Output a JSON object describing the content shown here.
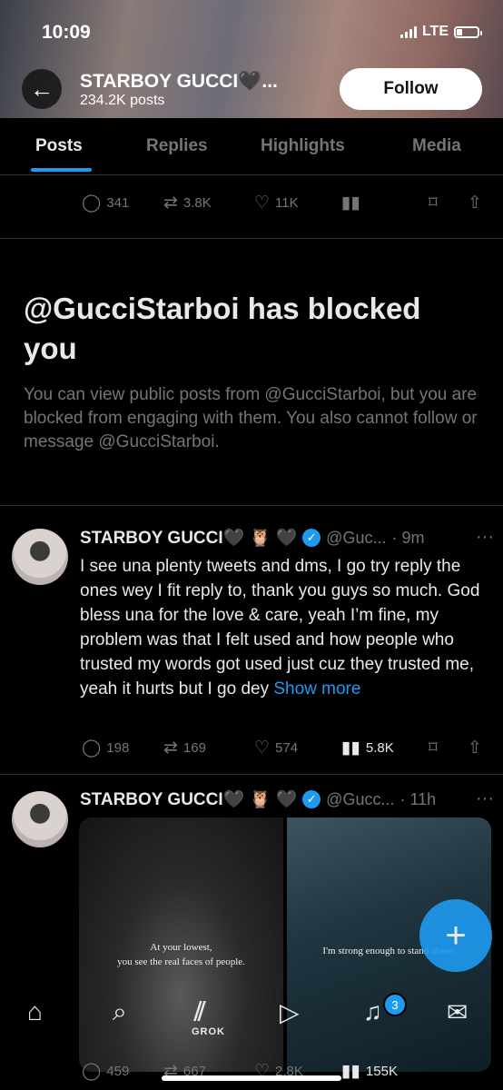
{
  "status_bar": {
    "time": "10:09",
    "network": "LTE"
  },
  "header": {
    "name": "STARBOY GUCCI🖤...",
    "posts_count": "234.2K posts",
    "follow_label": "Follow"
  },
  "tabs": [
    {
      "label": "Posts"
    },
    {
      "label": "Replies"
    },
    {
      "label": "Highlights"
    },
    {
      "label": "Media"
    }
  ],
  "prev_tweet_actions": {
    "replies": "341",
    "reposts": "3.8K",
    "likes": "11K"
  },
  "blocked_notice": {
    "title": "@GucciStarboi has blocked you",
    "text": "You can view public posts from @GucciStarboi, but you are blocked from engaging with them. You also cannot follow or message @GucciStarboi."
  },
  "tweet1": {
    "name": "STARBOY GUCCI🖤 🦉 🖤",
    "handle": "@Guc...",
    "time": "· 9m",
    "body": "I see una plenty tweets and dms, I go try reply the ones wey I fit reply to, thank you guys so much. God bless una for the love & care, yeah I’m fine, my problem was that I felt used and how people who trusted my words got used just cuz they trusted me, yeah it hurts but I go dey ",
    "show_more": "Show more",
    "replies": "198",
    "reposts": "169",
    "likes": "574",
    "views": "5.8K"
  },
  "tweet2": {
    "name": "STARBOY GUCCI🖤 🦉 🖤",
    "handle": "@Gucc...",
    "time": "· 11h",
    "image1_caption_1": "At your lowest,",
    "image1_caption_2": "you see the real faces of people.",
    "image2_caption": "I'm strong enough to stand alone.",
    "replies": "459",
    "reposts": "667",
    "likes": "2.8K",
    "views": "155K"
  },
  "bottom_nav": {
    "grok_label": "GROK",
    "notification_count": "3"
  },
  "colors": {
    "accent": "#1d9bf0",
    "background": "#000000",
    "muted": "#71767b"
  }
}
